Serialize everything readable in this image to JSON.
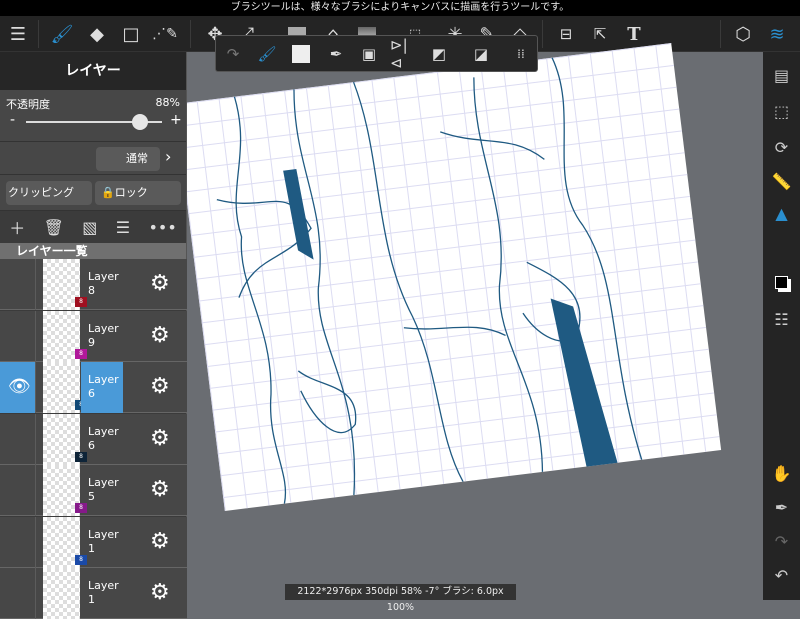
{
  "status_message": "ブラシツールは、様々なブラシによりキャンバスに描画を行うツールです。",
  "toolbar": {
    "icons": [
      "menu-icon",
      "brush-icon",
      "eraser-icon",
      "rectangle-icon",
      "vector-icon",
      "move-icon",
      "transform-icon",
      "fill-color-icon",
      "bucket-icon",
      "gradient-icon",
      "select-rect-icon",
      "magic-wand-icon",
      "select-pen-icon",
      "select-eraser-icon",
      "layout-icon",
      "select-arrow-icon",
      "text-icon",
      "3d-material-icon",
      "layers-icon"
    ],
    "accent": "#2a8fcf"
  },
  "popup": {
    "icons": [
      "redo-icon",
      "brush-swap-icon",
      "transparent-icon",
      "eyedropper-icon",
      "frame-icon",
      "flip-icon",
      "clear-icon",
      "snap-icon",
      "grid-icon"
    ]
  },
  "panel": {
    "title": "レイヤー",
    "opacity_label": "不透明度",
    "opacity_value": "88%",
    "opacity": 88,
    "minus": "-",
    "plus": "+",
    "blend_mode": "通常",
    "clipping": "クリッピング",
    "lock": "ロック",
    "list_header": "レイヤー一覧",
    "layers": [
      {
        "name": "Layer 8",
        "badge": "8",
        "color": "#a01020",
        "selected": false
      },
      {
        "name": "Layer 9",
        "badge": "8",
        "color": "#b0189a",
        "selected": false
      },
      {
        "name": "Layer 6",
        "badge": "8",
        "color": "#124a78",
        "selected": true
      },
      {
        "name": "Layer 6",
        "badge": "8",
        "color": "#0e2438",
        "selected": false
      },
      {
        "name": "Layer 5",
        "badge": "8",
        "color": "#861a8a",
        "selected": false
      },
      {
        "name": "Layer 1",
        "badge": "8",
        "color": "#1a4aa8",
        "selected": false
      },
      {
        "name": "Layer 1",
        "badge": "",
        "color": "#a03030",
        "selected": false
      }
    ]
  },
  "canvas_info": "2122*2976px 350dpi 58% -7° ブラシ: 6.0px 100%",
  "right_bar": {
    "icons": [
      "pages-icon",
      "selection-list-icon",
      "rotate-icon",
      "ruler-icon",
      "brush-color-icon",
      "color-swatch-icon",
      "layer-list-icon",
      "hand-icon",
      "eyedropper-icon",
      "redo-icon",
      "undo-icon"
    ]
  },
  "line_color": "#1f5a82"
}
